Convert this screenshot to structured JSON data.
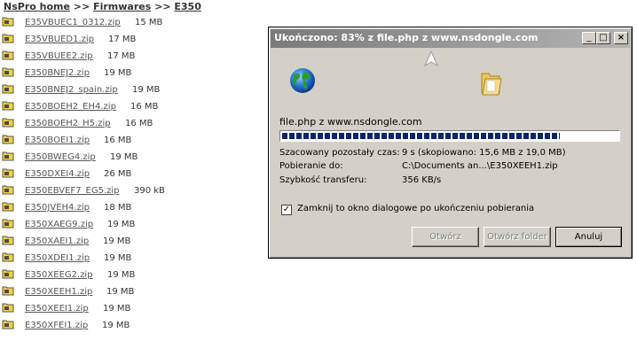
{
  "breadcrumb": {
    "home": "NsPro home",
    "sep1": ">>",
    "firmwares": "Firmwares",
    "sep2": ">>",
    "model": "E350"
  },
  "files": [
    {
      "name": "E35VBUEC1_0312.zip",
      "size": "15 MB"
    },
    {
      "name": "E35VBUED1.zip",
      "size": "17 MB"
    },
    {
      "name": "E35VBUEE2.zip",
      "size": "17 MB"
    },
    {
      "name": "E350BNEJ2.zip",
      "size": "19 MB"
    },
    {
      "name": "E350BNEJ2_spain.zip",
      "size": "19 MB"
    },
    {
      "name": "E350BOEH2_EH4.zip",
      "size": "16 MB"
    },
    {
      "name": "E350BOEH2_H5.zip",
      "size": "16 MB"
    },
    {
      "name": "E350BOEI1.zip",
      "size": "16 MB"
    },
    {
      "name": "E350BWEG4.zip",
      "size": "19 MB"
    },
    {
      "name": "E350DXEI4.zip",
      "size": "26 MB"
    },
    {
      "name": "E350EBVEF7_EG5.zip",
      "size": "390 kB"
    },
    {
      "name": "E350JVEH4.zip",
      "size": "18 MB"
    },
    {
      "name": "E350XAEG9.zip",
      "size": "19 MB"
    },
    {
      "name": "E350XAEI1.zip",
      "size": "19 MB"
    },
    {
      "name": "E350XDEI1.zip",
      "size": "19 MB"
    },
    {
      "name": "E350XEEG2.zip",
      "size": "19 MB"
    },
    {
      "name": "E350XEEH1.zip",
      "size": "19 MB"
    },
    {
      "name": "E350XEEI1.zip",
      "size": "19 MB"
    },
    {
      "name": "E350XFEI1.zip",
      "size": "19 MB"
    }
  ],
  "dialog": {
    "title": "Ukończono: 83% z file.php z www.nsdongle.com",
    "title_buttons": {
      "minimize": "_",
      "maximize": "□",
      "close": "×"
    },
    "status": "file.php z www.nsdongle.com",
    "progress": 0.83,
    "info": [
      {
        "label": "Szacowany pozostały czas:",
        "value": "9 s (skopiowano: 15,6 MB z 19,0 MB)"
      },
      {
        "label": "Pobieranie do:",
        "value": "C:\\Documents an...\\E350XEEH1.zip"
      },
      {
        "label": "Szybkość transferu:",
        "value": "356 KB/s"
      }
    ],
    "checkbox_label": "Zamknij to okno dialogowe po ukończeniu pobierania",
    "checkbox_checked": true,
    "checkbox_mark": "✓",
    "buttons": {
      "open": "Otwórz",
      "open_folder": "Otwórz folder",
      "cancel": "Anuluj"
    }
  },
  "icons": {
    "file_icon": "folder-icon",
    "globe": "globe-icon",
    "paper": "flying-document-icon",
    "folder": "folder-open-icon"
  }
}
